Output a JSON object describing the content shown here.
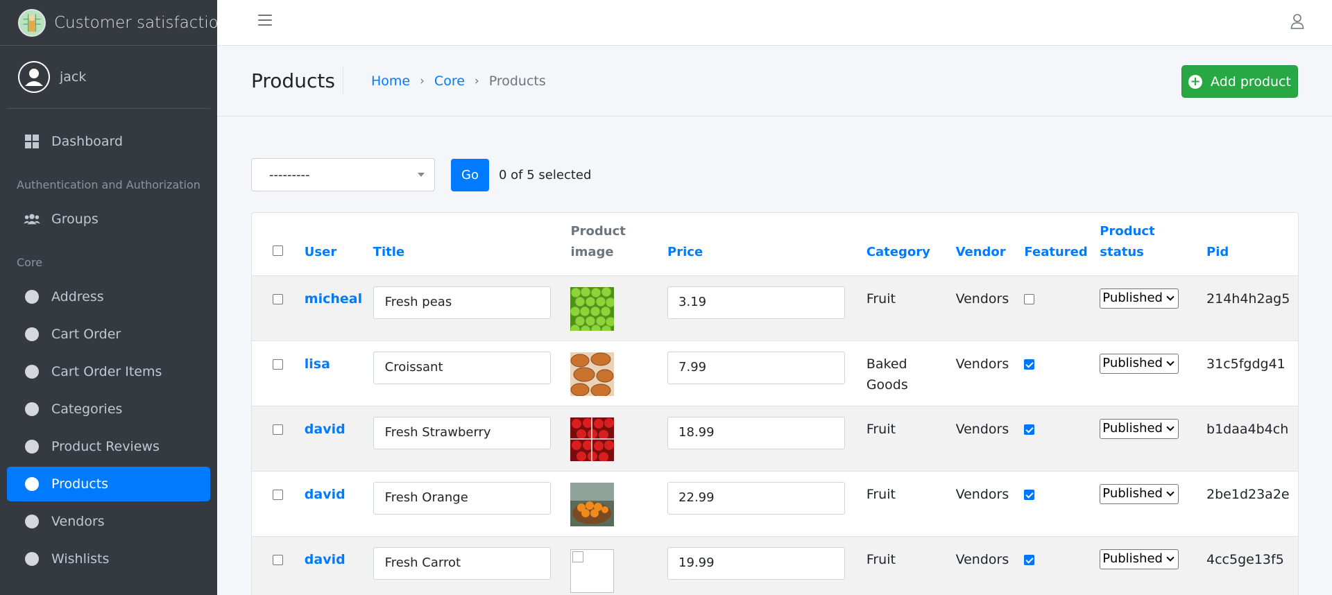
{
  "brand": {
    "title": "Customer satisfaction is"
  },
  "user": {
    "name": "jack"
  },
  "sidebar": {
    "dashboard": "Dashboard",
    "section_auth": "Authentication and Authorization",
    "groups": "Groups",
    "section_core": "Core",
    "items": [
      {
        "label": "Address",
        "active": false
      },
      {
        "label": "Cart Order",
        "active": false
      },
      {
        "label": "Cart Order Items",
        "active": false
      },
      {
        "label": "Categories",
        "active": false
      },
      {
        "label": "Product Reviews",
        "active": false
      },
      {
        "label": "Products",
        "active": true
      },
      {
        "label": "Vendors",
        "active": false
      },
      {
        "label": "Wishlists",
        "active": false
      }
    ]
  },
  "header": {
    "title": "Products",
    "breadcrumb": {
      "home": "Home",
      "core": "Core",
      "current": "Products",
      "separator": "›"
    },
    "add_button": "Add product"
  },
  "actions": {
    "select_value": "---------",
    "go_label": "Go",
    "selected_text": "0 of 5 selected"
  },
  "table": {
    "columns": {
      "user": "User",
      "title": "Title",
      "image_line1": "Product",
      "image_line2": "image",
      "price": "Price",
      "category": "Category",
      "vendor": "Vendor",
      "featured": "Featured",
      "status_line1": "Product",
      "status_line2": "status",
      "pid": "Pid"
    },
    "rows": [
      {
        "user": "micheal",
        "title": "Fresh peas",
        "image": "peas",
        "price": "3.19",
        "category_line1": "Fruit",
        "category_line2": "",
        "vendor": "Vendors",
        "featured": false,
        "status": "Published",
        "pid": "214h4h2ag5"
      },
      {
        "user": "lisa",
        "title": "Croissant",
        "image": "croissant",
        "price": "7.99",
        "category_line1": "Baked",
        "category_line2": "Goods",
        "vendor": "Vendors",
        "featured": true,
        "status": "Published",
        "pid": "31c5fgdg41"
      },
      {
        "user": "david",
        "title": "Fresh Strawberry",
        "image": "strawberry",
        "price": "18.99",
        "category_line1": "Fruit",
        "category_line2": "",
        "vendor": "Vendors",
        "featured": true,
        "status": "Published",
        "pid": "b1daa4b4ch"
      },
      {
        "user": "david",
        "title": "Fresh Orange",
        "image": "orange",
        "price": "22.99",
        "category_line1": "Fruit",
        "category_line2": "",
        "vendor": "Vendors",
        "featured": true,
        "status": "Published",
        "pid": "2be1d23a2e"
      },
      {
        "user": "david",
        "title": "Fresh Carrot",
        "image": "broken",
        "price": "19.99",
        "category_line1": "Fruit",
        "category_line2": "",
        "vendor": "Vendors",
        "featured": true,
        "status": "Published",
        "pid": "4cc5ge13f5"
      }
    ]
  },
  "colors": {
    "sidebar_bg": "#343a40",
    "accent": "#007bff",
    "success": "#28a745"
  }
}
